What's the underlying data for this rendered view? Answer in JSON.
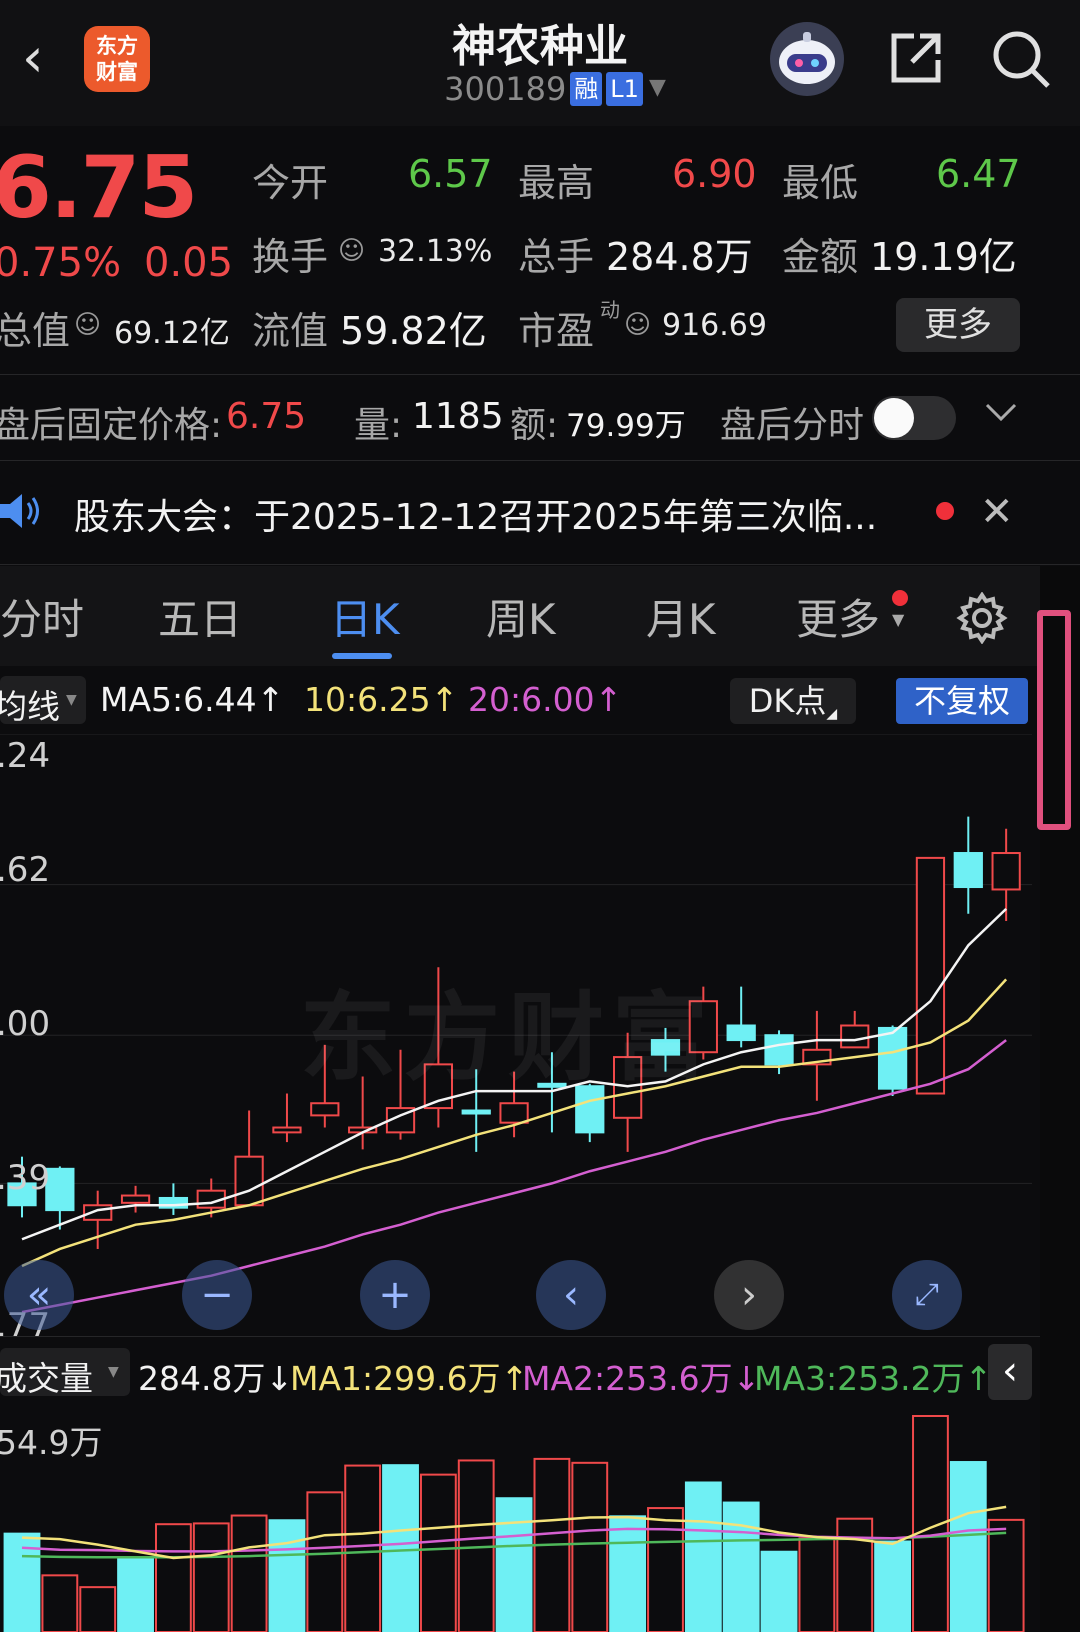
{
  "header": {
    "back_icon": "chevron-left-icon",
    "logo_line1": "东方",
    "logo_line2": "财富",
    "stock_name": "神农种业",
    "stock_code": "300189",
    "tag_margin": "融",
    "tag_level": "L1",
    "icons": [
      "robot-avatar-icon",
      "share-icon",
      "search-icon"
    ]
  },
  "quote": {
    "price": "6.75",
    "change_pct": "0.75%",
    "change_val": "0.05",
    "open_label": "今开",
    "open": "6.57",
    "high_label": "最高",
    "high": "6.90",
    "low_label": "最低",
    "low": "6.47",
    "turnover_label": "换手",
    "turnover": "32.13%",
    "volume_label": "总手",
    "volume": "284.8万",
    "amount_label": "金额",
    "amount": "19.19亿",
    "mktcap_label": "总值",
    "mktcap": "69.12亿",
    "float_label": "流值",
    "float_cap": "59.82亿",
    "pe_label": "市盈",
    "pe_sup": "动",
    "pe": "916.69",
    "more_label": "更多",
    "colors": {
      "up": "#f0494a",
      "down": "#5ec84a"
    }
  },
  "after_hours": {
    "label": "盘后固定价格:",
    "price": "6.75",
    "vol_label": "量:",
    "vol": "1185",
    "amt_label": "额:",
    "amt": "79.99万",
    "toggle_label": "盘后分时",
    "toggle_on": false
  },
  "notice": {
    "text": "股东大会：于2025-12-12召开2025年第三次临..."
  },
  "tabs": [
    {
      "label": "分时",
      "active": false
    },
    {
      "label": "五日",
      "active": false
    },
    {
      "label": "日K",
      "active": true
    },
    {
      "label": "周K",
      "active": false
    },
    {
      "label": "月K",
      "active": false
    },
    {
      "label": "更多",
      "active": false
    }
  ],
  "ma_bar": {
    "selector": "均线",
    "ma5": "MA5:6.44",
    "ma10": "10:6.25",
    "ma20": "20:6.00",
    "dk_label": "DK点",
    "adjust_label": "不复权",
    "colors": {
      "ma5": "#f4f4f4",
      "ma10": "#f3e27a",
      "ma20": "#d45fd0"
    }
  },
  "price_axis": [
    ".24",
    ".62",
    ".00",
    ".39",
    ".77"
  ],
  "volume_bar": {
    "selector": "成交量",
    "value": "284.8万",
    "ma1": "MA1:299.6万",
    "ma2": "MA2:253.6万",
    "ma3": "MA3:253.2万",
    "axis_top": "54.9万",
    "colors": {
      "ma1": "#f3e27a",
      "ma2": "#d45fd0",
      "ma3": "#4fb85a"
    }
  },
  "watermark": "东方财富",
  "chart_data": {
    "type": "candlestick",
    "y_ticks_visible": [
      ".24",
      ".62",
      ".00",
      ".39",
      ".77"
    ],
    "candles": [
      {
        "o": 5.39,
        "c": 5.3,
        "h": 5.5,
        "l": 5.25
      },
      {
        "o": 5.45,
        "c": 5.28,
        "h": 5.46,
        "l": 5.2
      },
      {
        "o": 5.24,
        "c": 5.3,
        "h": 5.36,
        "l": 5.12
      },
      {
        "o": 5.31,
        "c": 5.34,
        "h": 5.38,
        "l": 5.27
      },
      {
        "o": 5.33,
        "c": 5.29,
        "h": 5.39,
        "l": 5.26
      },
      {
        "o": 5.29,
        "c": 5.36,
        "h": 5.41,
        "l": 5.25
      },
      {
        "o": 5.3,
        "c": 5.5,
        "h": 5.69,
        "l": 5.3
      },
      {
        "o": 5.6,
        "c": 5.62,
        "h": 5.76,
        "l": 5.56
      },
      {
        "o": 5.67,
        "c": 5.72,
        "h": 5.96,
        "l": 5.62
      },
      {
        "o": 5.6,
        "c": 5.62,
        "h": 5.83,
        "l": 5.53
      },
      {
        "o": 5.6,
        "c": 5.7,
        "h": 5.94,
        "l": 5.57
      },
      {
        "o": 5.7,
        "c": 5.88,
        "h": 6.28,
        "l": 5.62
      },
      {
        "o": 5.69,
        "c": 5.68,
        "h": 5.86,
        "l": 5.52
      },
      {
        "o": 5.64,
        "c": 5.72,
        "h": 5.85,
        "l": 5.58
      },
      {
        "o": 5.8,
        "c": 5.79,
        "h": 5.93,
        "l": 5.6
      },
      {
        "o": 5.79,
        "c": 5.6,
        "h": 5.8,
        "l": 5.56
      },
      {
        "o": 5.66,
        "c": 5.91,
        "h": 6.01,
        "l": 5.52
      },
      {
        "o": 5.98,
        "c": 5.92,
        "h": 6.03,
        "l": 5.85
      },
      {
        "o": 5.93,
        "c": 6.14,
        "h": 6.2,
        "l": 5.9
      },
      {
        "o": 6.04,
        "c": 5.98,
        "h": 6.2,
        "l": 5.95
      },
      {
        "o": 6.0,
        "c": 5.88,
        "h": 6.02,
        "l": 5.84
      },
      {
        "o": 5.88,
        "c": 5.94,
        "h": 6.1,
        "l": 5.73
      },
      {
        "o": 5.95,
        "c": 6.04,
        "h": 6.1,
        "l": 5.95
      },
      {
        "o": 6.03,
        "c": 5.78,
        "h": 6.04,
        "l": 5.75
      },
      {
        "o": 5.76,
        "c": 6.73,
        "h": 6.73,
        "l": 5.76
      },
      {
        "o": 6.75,
        "c": 6.61,
        "h": 6.9,
        "l": 6.5
      },
      {
        "o": 6.6,
        "c": 6.75,
        "h": 6.85,
        "l": 6.47
      }
    ],
    "ma5": [
      5.16,
      5.22,
      5.28,
      5.3,
      5.3,
      5.31,
      5.36,
      5.44,
      5.52,
      5.6,
      5.67,
      5.73,
      5.77,
      5.77,
      5.77,
      5.81,
      5.79,
      5.81,
      5.88,
      5.93,
      5.96,
      5.98,
      5.98,
      6.01,
      6.14,
      6.37,
      6.52
    ],
    "ma10": [
      5.05,
      5.12,
      5.17,
      5.22,
      5.24,
      5.27,
      5.3,
      5.35,
      5.4,
      5.45,
      5.49,
      5.54,
      5.59,
      5.63,
      5.68,
      5.73,
      5.76,
      5.79,
      5.83,
      5.87,
      5.87,
      5.89,
      5.91,
      5.93,
      5.97,
      6.06,
      6.23
    ],
    "ma20": [
      4.86,
      4.89,
      4.92,
      4.95,
      4.98,
      5.01,
      5.05,
      5.09,
      5.13,
      5.18,
      5.22,
      5.27,
      5.31,
      5.35,
      5.39,
      5.44,
      5.48,
      5.52,
      5.57,
      5.61,
      5.65,
      5.68,
      5.72,
      5.76,
      5.8,
      5.86,
      5.98
    ],
    "volume_ma": {
      "ma1": [
        240,
        236,
        222,
        205,
        188,
        195,
        215,
        226,
        246,
        250,
        258,
        265,
        272,
        278,
        284,
        291,
        292,
        284,
        281,
        271,
        253,
        241,
        236,
        224,
        265,
        302,
        318
      ],
      "ma2": [
        214,
        209,
        208,
        206,
        205,
        205,
        207,
        210,
        214,
        219,
        224,
        231,
        238,
        244,
        251,
        258,
        262,
        261,
        258,
        254,
        247,
        242,
        240,
        238,
        245,
        258,
        262
      ],
      "ma3": [
        193,
        191,
        190,
        190,
        190,
        191,
        193,
        196,
        199,
        203,
        207,
        211,
        215,
        219,
        222,
        225,
        227,
        229,
        231,
        233,
        234,
        236,
        237,
        238,
        242,
        247,
        252
      ]
    },
    "volumes": [
      250,
      144,
      114,
      187,
      274,
      276,
      296,
      284,
      355,
      423,
      424,
      400,
      436,
      340,
      440,
      430,
      294,
      315,
      380,
      329,
      204,
      238,
      288,
      230,
      549,
      432,
      285
    ],
    "volume_up": [
      false,
      true,
      true,
      false,
      true,
      true,
      true,
      false,
      true,
      true,
      false,
      true,
      true,
      false,
      true,
      true,
      false,
      true,
      false,
      false,
      false,
      true,
      true,
      false,
      true,
      false,
      true
    ],
    "price_range": [
      4.77,
      7.24
    ],
    "volume_max": 549
  },
  "nav_controls": {
    "icons": [
      "double-left-icon",
      "zoom-out-icon",
      "zoom-in-icon",
      "prev-icon",
      "next-icon",
      "fullscreen-icon"
    ]
  }
}
